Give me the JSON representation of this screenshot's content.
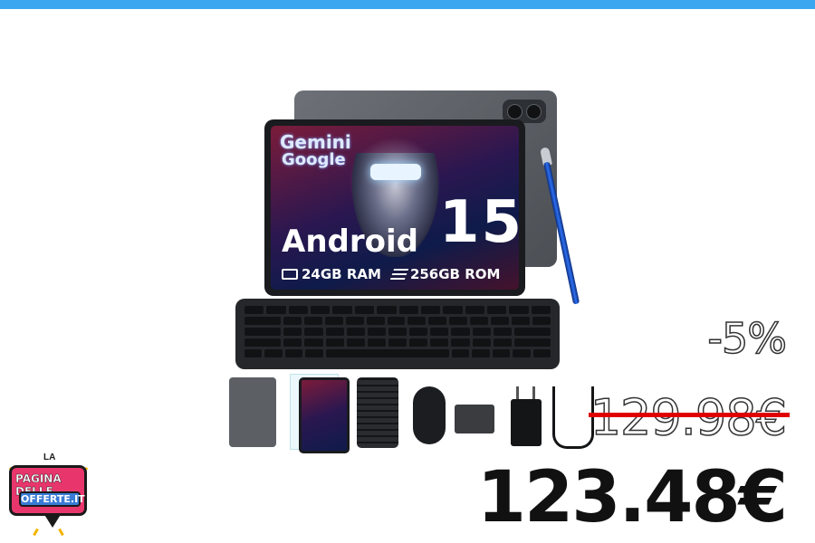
{
  "product": {
    "screen_brand_line1": "Gemini",
    "screen_brand_line2": "Google",
    "os_name": "Android",
    "os_version": "15",
    "ram": "24GB RAM",
    "rom": "256GB ROM",
    "icons": [
      "memory-chip-icon",
      "storage-stack-icon"
    ]
  },
  "pricing": {
    "discount": "-5%",
    "old_price": "129.98€",
    "new_price": "123.48€",
    "strike_color": "#e00000"
  },
  "logo": {
    "top": "LA",
    "line1": "PAGINA DELLE",
    "line2": "OFFERTE.IT"
  },
  "colors": {
    "top_bar": "#3aa7f0",
    "logo_pink": "#e8366d",
    "logo_blue": "#3a7bd5"
  }
}
